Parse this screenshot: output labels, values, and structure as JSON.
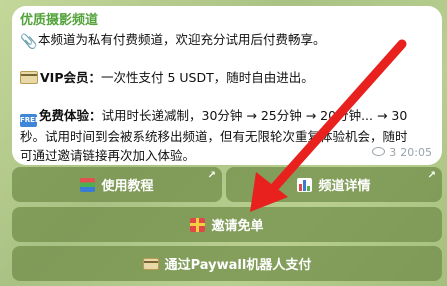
{
  "message": {
    "title": "优质摄影频道",
    "line1": "本频道为私有付费频道，欢迎充分试用后付费畅享。",
    "vip_label": "VIP会员：",
    "vip_text": "一次性支付 5 USDT，随时自由进出。",
    "free_badge": "FREE",
    "trial_label": "免费体验：",
    "trial_text1": "试用时长递减制，30分钟 → 25分钟 → 20分钟... → 30",
    "trial_text2": "秒。试用时间到会被系统移出频道，但有无限轮次重复体验机会，随时",
    "trial_text3": "可通过邀请链接再次加入体验。",
    "views": "3",
    "time": "20:05"
  },
  "buttons": {
    "tutorial": "使用教程",
    "details": "频道详情",
    "invite": "邀请免单",
    "paywall": "通过Paywall机器人支付"
  },
  "icons": {
    "attachment": "paperclip-icon",
    "vip": "credit-card-icon",
    "free": "free-badge-icon",
    "views": "eye-icon",
    "tutorial": "books-icon",
    "details": "bar-chart-icon",
    "invite": "gift-icon",
    "paywall": "credit-card-icon",
    "external": "external-link-arrow-icon",
    "annotation": "red-arrow-icon"
  },
  "colors": {
    "title": "#54a33c",
    "annotation_arrow": "#e8201e"
  }
}
